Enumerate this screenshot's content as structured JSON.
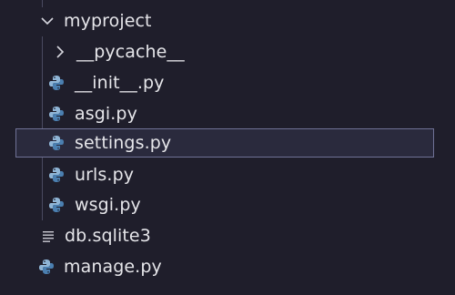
{
  "tree": {
    "top_cut_label": "",
    "folder": {
      "name": "myproject",
      "expanded": true
    },
    "subfolder": {
      "name": "__pycache__",
      "expanded": false
    },
    "files": [
      {
        "name": "__init__.py",
        "icon": "python-icon"
      },
      {
        "name": "asgi.py",
        "icon": "python-icon"
      },
      {
        "name": "settings.py",
        "icon": "python-icon",
        "selected": true
      },
      {
        "name": "urls.py",
        "icon": "python-icon"
      },
      {
        "name": "wsgi.py",
        "icon": "python-icon"
      }
    ],
    "root_files": [
      {
        "name": "db.sqlite3",
        "icon": "text-file-icon"
      },
      {
        "name": "manage.py",
        "icon": "python-icon"
      }
    ]
  },
  "colors": {
    "background": "#1f1e2b",
    "text": "#e6e6ea",
    "python_blue": "#4b7fb0",
    "python_light": "#8fb5d6",
    "selection_border": "#6f7296",
    "selection_fill": "#2a2a3d"
  }
}
